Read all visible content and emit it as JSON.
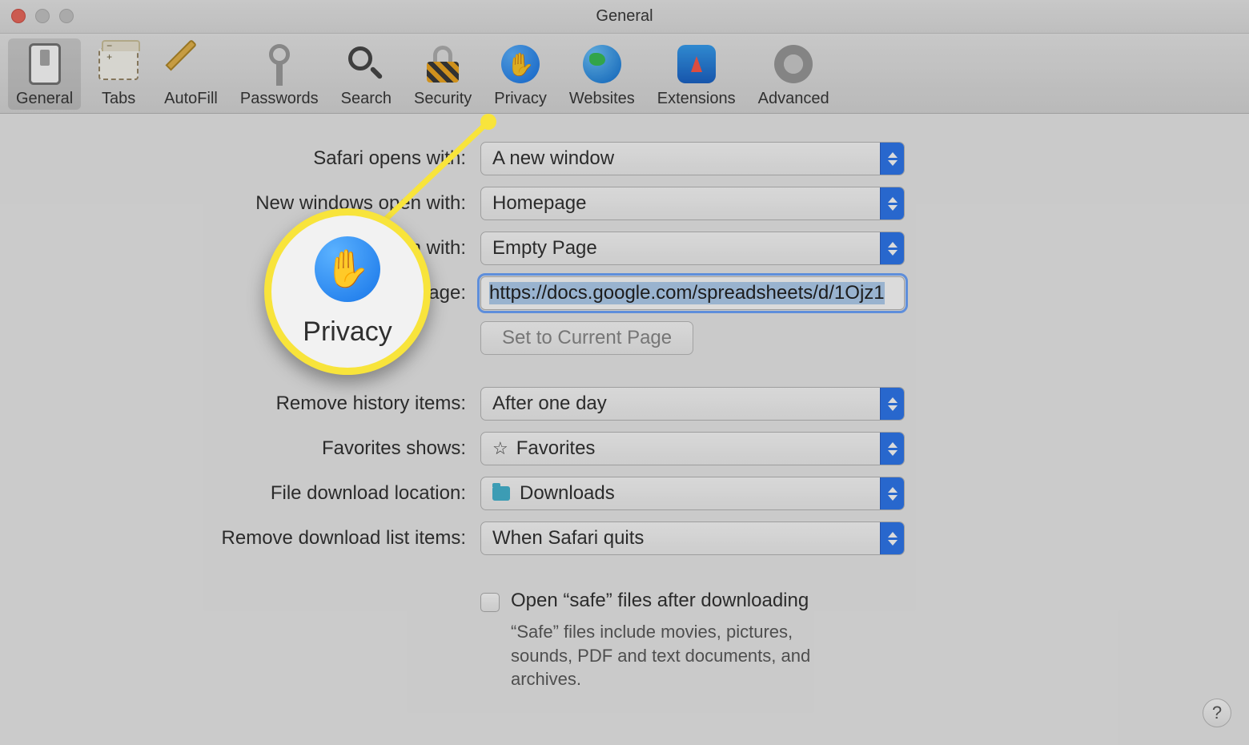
{
  "window": {
    "title": "General"
  },
  "toolbar": [
    {
      "id": "general",
      "label": "General"
    },
    {
      "id": "tabs",
      "label": "Tabs"
    },
    {
      "id": "autofill",
      "label": "AutoFill"
    },
    {
      "id": "passwords",
      "label": "Passwords"
    },
    {
      "id": "search",
      "label": "Search"
    },
    {
      "id": "security",
      "label": "Security"
    },
    {
      "id": "privacy",
      "label": "Privacy"
    },
    {
      "id": "websites",
      "label": "Websites"
    },
    {
      "id": "extensions",
      "label": "Extensions"
    },
    {
      "id": "advanced",
      "label": "Advanced"
    }
  ],
  "settings": {
    "safari_opens_with": {
      "label": "Safari opens with:",
      "value": "A new window"
    },
    "new_windows_open_with": {
      "label": "New windows open with:",
      "value": "Homepage"
    },
    "new_tabs_open_with": {
      "label": "open with:",
      "value": "Empty Page"
    },
    "homepage": {
      "label": "omepage:",
      "value": "https://docs.google.com/spreadsheets/d/1Ojz1"
    },
    "set_current": {
      "label": "Set to Current Page"
    },
    "remove_history": {
      "label": "Remove history items:",
      "value": "After one day"
    },
    "favorites_shows": {
      "label": "Favorites shows:",
      "value": "Favorites"
    },
    "download_location": {
      "label": "File download location:",
      "value": "Downloads"
    },
    "remove_download_list": {
      "label": "Remove download list items:",
      "value": "When Safari quits"
    },
    "open_safe": {
      "headline": "Open “safe” files after downloading",
      "sub": "“Safe” files include movies, pictures, sounds, PDF and text documents, and archives."
    }
  },
  "callout": {
    "label": "Privacy"
  },
  "help": {
    "label": "?"
  }
}
